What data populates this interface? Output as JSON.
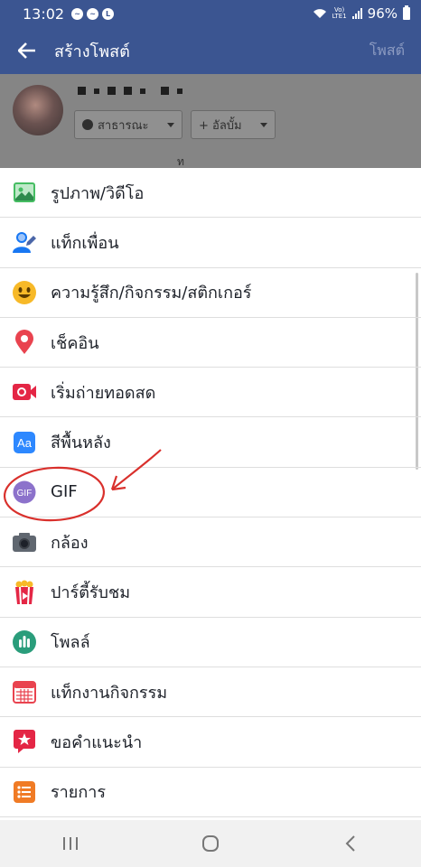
{
  "status_bar": {
    "time": "13:02",
    "network_label": "LTE1",
    "volte_label": "Vo)",
    "battery": "96%",
    "left_icons": [
      "messenger-icon",
      "messenger-icon",
      "line-icon"
    ]
  },
  "header": {
    "title": "สร้างโพสต์",
    "post_button": "โพสต์"
  },
  "composer": {
    "privacy_label": "สาธารณะ",
    "album_label": "+ อัลบั้ม",
    "hint_text": "ท"
  },
  "menu": {
    "items": [
      {
        "label": "รูปภาพ/วิดีโอ",
        "icon": "photo-icon",
        "color": "#45bd62"
      },
      {
        "label": "แท็กเพื่อน",
        "icon": "tag-friends-icon",
        "color": "#1877f2"
      },
      {
        "label": "ความรู้สึก/กิจกรรม/สติกเกอร์",
        "icon": "emoji-icon",
        "color": "#f7b928"
      },
      {
        "label": "เช็คอิน",
        "icon": "location-pin-icon",
        "color": "#e9434f"
      },
      {
        "label": "เริ่มถ่ายทอดสด",
        "icon": "live-video-icon",
        "color": "#e42645"
      },
      {
        "label": "สีพื้นหลัง",
        "icon": "background-color-icon",
        "color": "#2d88ff"
      },
      {
        "label": "GIF",
        "icon": "gif-icon",
        "color": "#8c72cb"
      },
      {
        "label": "กล้อง",
        "icon": "camera-icon",
        "color": "#606770"
      },
      {
        "label": "ปาร์ตี้รับชม",
        "icon": "watch-party-icon",
        "color": "#e42645"
      },
      {
        "label": "โพลล์",
        "icon": "poll-icon",
        "color": "#2a9d7b"
      },
      {
        "label": "แท็กงานกิจกรรม",
        "icon": "event-calendar-icon",
        "color": "#e9434f"
      },
      {
        "label": "ขอคำแนะนำ",
        "icon": "recommendation-icon",
        "color": "#e42645"
      },
      {
        "label": "รายการ",
        "icon": "list-icon",
        "color": "#f07b25"
      }
    ]
  },
  "annotation": {
    "target": "GIF",
    "color": "#d9302c"
  },
  "colors": {
    "brand_blue": "#3b5591",
    "text": "#1d2129",
    "divider": "#dedede"
  }
}
